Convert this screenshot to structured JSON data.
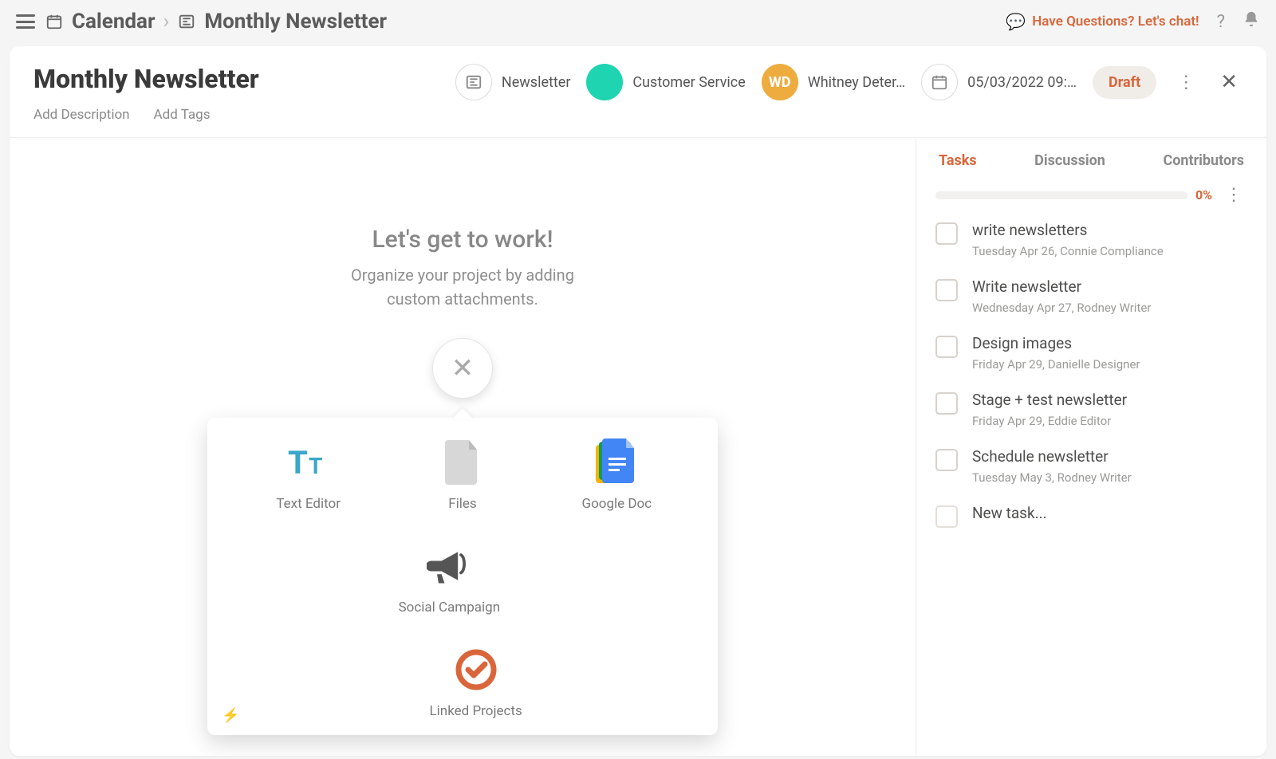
{
  "breadcrumb": {
    "root": "Calendar",
    "current": "Monthly Newsletter"
  },
  "topbar": {
    "chat": "Have Questions? Let's chat!"
  },
  "header": {
    "title": "Monthly Newsletter",
    "add_description": "Add Description",
    "add_tags": "Add Tags",
    "chips": {
      "newsletter": "Newsletter",
      "customer_service": "Customer Service",
      "owner_initials": "WD",
      "owner_name": "Whitney Deter…",
      "date": "05/03/2022 09:…",
      "status": "Draft"
    }
  },
  "main": {
    "hero_title": "Let's get to work!",
    "hero_sub": "Organize your project by adding custom attachments.",
    "attachments": [
      "Text Editor",
      "Files",
      "Google Doc",
      "Social Campaign",
      "Linked Projects"
    ]
  },
  "sidebar": {
    "tabs": {
      "tasks": "Tasks",
      "discussion": "Discussion",
      "contributors": "Contributors"
    },
    "progress": "0%",
    "tasks": [
      {
        "title": "write newsletters",
        "meta": "Tuesday Apr 26,   Connie Compliance"
      },
      {
        "title": "Write newsletter",
        "meta": "Wednesday Apr 27,   Rodney Writer"
      },
      {
        "title": "Design images",
        "meta": "Friday Apr 29,   Danielle Designer"
      },
      {
        "title": "Stage + test newsletter",
        "meta": "Friday Apr 29,   Eddie Editor"
      },
      {
        "title": "Schedule newsletter",
        "meta": "Tuesday May 3,   Rodney Writer"
      }
    ],
    "new_task_placeholder": "New task..."
  }
}
